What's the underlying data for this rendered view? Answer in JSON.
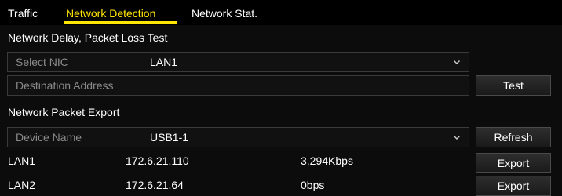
{
  "tabs": [
    {
      "label": "Traffic",
      "active": false
    },
    {
      "label": "Network Detection",
      "active": true
    },
    {
      "label": "Network Stat.",
      "active": false
    }
  ],
  "delay_test": {
    "title": "Network Delay, Packet Loss Test",
    "select_nic_label": "Select NIC",
    "select_nic_value": "LAN1",
    "destination_label": "Destination Address",
    "destination_value": "",
    "test_button": "Test"
  },
  "packet_export": {
    "title": "Network Packet Export",
    "device_name_label": "Device Name",
    "device_name_value": "USB1-1",
    "refresh_button": "Refresh",
    "rows": [
      {
        "interface": "LAN1",
        "ip": "172.6.21.110",
        "rate": "3,294Kbps",
        "export_label": "Export"
      },
      {
        "interface": "LAN2",
        "ip": "172.6.21.64",
        "rate": "0bps",
        "export_label": "Export"
      }
    ]
  },
  "colors": {
    "background": "#0c0c0c",
    "active_tab": "#ffe600",
    "muted_label": "#8a8a8a"
  },
  "icons": {
    "dropdown": "chevron-down-icon"
  }
}
